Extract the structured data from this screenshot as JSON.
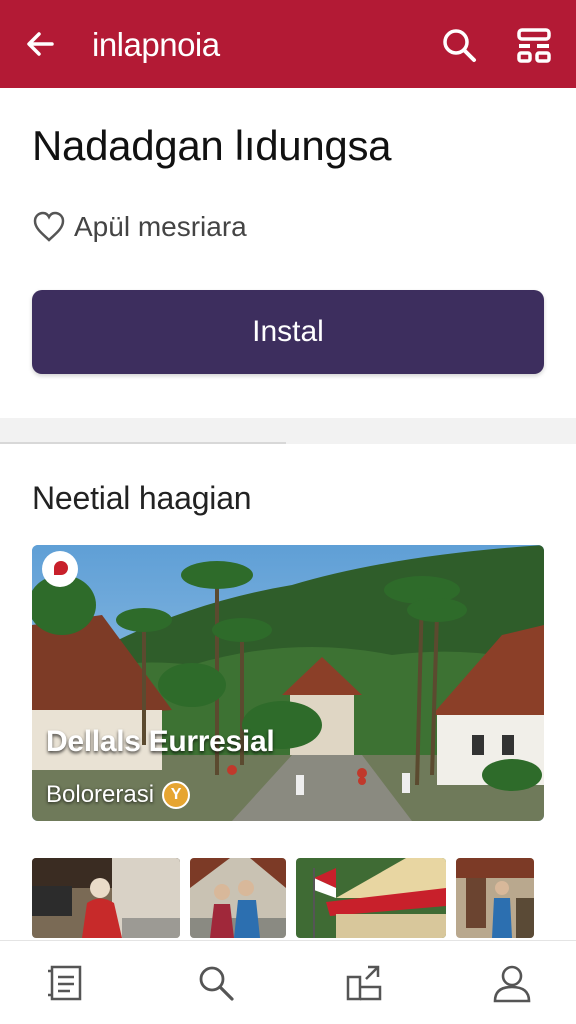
{
  "header": {
    "title": "inlapnoia",
    "back_icon": "arrow-left-icon",
    "search_icon": "search-icon",
    "menu_icon": "apps-icon",
    "background_color": "#b31a35"
  },
  "app": {
    "title": "Nadadgan lıdungsa",
    "wishlist_label": "Apül mesriara",
    "install_label": "Instal",
    "install_color": "#3d2e5e"
  },
  "section": {
    "title": "Neetial haagian"
  },
  "featured": {
    "title": "Dellals Eurresial",
    "subtitle": "Bolorerasi",
    "badge": "Y"
  },
  "bottom_nav": {
    "items": [
      {
        "icon": "document-icon"
      },
      {
        "icon": "search-icon"
      },
      {
        "icon": "share-icon"
      },
      {
        "icon": "profile-icon"
      }
    ]
  }
}
